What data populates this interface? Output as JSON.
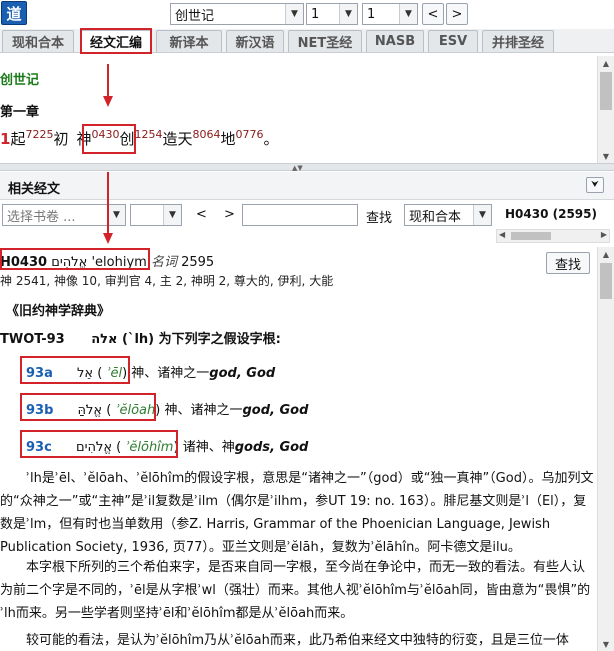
{
  "toolbar": {
    "logo": "道",
    "book_select": "创世记",
    "chapter_select": "1",
    "verse_select": "1",
    "prev": "<",
    "next": ">"
  },
  "tabs": [
    {
      "label": "现和合本",
      "active": false
    },
    {
      "label": "经文汇编",
      "active": true
    },
    {
      "label": "新译本",
      "active": false
    },
    {
      "label": "新汉语",
      "active": false
    },
    {
      "label": "NET圣经",
      "active": false
    },
    {
      "label": "NASB",
      "active": false
    },
    {
      "label": "ESV",
      "active": false
    },
    {
      "label": "并排圣经",
      "active": false
    }
  ],
  "passage": {
    "book": "创世记",
    "chapter": "第一章",
    "verse_num": "1",
    "words": [
      {
        "text": "起",
        "strong": "7225"
      },
      {
        "text": "初",
        "strong": ""
      },
      {
        "text": "神",
        "strong": "0430"
      },
      {
        "text": "创",
        "strong": "1254"
      },
      {
        "text": "造天",
        "strong": "8064"
      },
      {
        "text": "地",
        "strong": "0776"
      },
      {
        "text": "。",
        "strong": ""
      }
    ]
  },
  "related": {
    "title": "相关经文",
    "book_placeholder": "选择书卷 ...",
    "prev": "<",
    "next": ">",
    "search_label": "查找",
    "version": "现和合本",
    "lemma_header": "H0430 (2595)"
  },
  "lexicon": {
    "search_button": "查找",
    "code": "H0430",
    "hebrew": "אֱלֹהִים",
    "translit": "'elohiym",
    "pos": "名词",
    "count": "2595",
    "glosses": "神 2541, 神像 10, 审判官 4, 主 2, 神明 2, 尊大的, 伊利, 大能",
    "book_title": "《旧约神学辞典》",
    "twot_label": "TWOT-93",
    "twot_hebrew": "אלה",
    "twot_root": "(`lh) 为下列字之假设字根:",
    "entries": [
      {
        "id": "93a",
        "hebrew": "אֵל",
        "translit": "ʾēl",
        "gloss": "神、诸神之一",
        "eng": "god, God"
      },
      {
        "id": "93b",
        "hebrew": "אֱלֹהַּ",
        "translit": "ʾĕlōah",
        "gloss": "神、诸神之一",
        "eng": "god, God"
      },
      {
        "id": "93c",
        "hebrew": "אֱלֹהִים",
        "translit": "ʾĕlōhîm",
        "gloss": "诸神、神",
        "eng": "gods, God"
      }
    ],
    "p1": "ʾlh是ʾēl、ʾĕlōah、ʾĕlōhîm的假设字根，意思是“诸神之一”（god）或“独一真神”（God）。乌加列文的“众神之一”或“主神”是ʾil复数是ʾilm（偶尔是ʾilhm，参UT 19: no. 163）。腓尼基文则是ʾl（El），复数是ʾlm，但有时也当单数用（参Z. Harris, Grammar of the Phoenician Language, Jewish Publication Society, 1936, 页77）。亚兰文则是ʾĕlāh，复数为ʾĕlāhîn。阿卡德文是ilu。",
    "p2": "本字根下所列的三个希伯来字，是否来自同一字根，至今尚在争论中，而无一致的看法。有些人认为前二个字是不同的，ʾēl是从字根ʾwl（强壮）而来。其他人视ʾĕlōhîm与ʾĕlōah同，皆由意为“畏惧”的ʾlh而来。另一些学者则坚持ʾēl和ʾĕlōhîm都是从ʾĕlōah而来。",
    "p3": "较可能的看法，是认为ʾĕlōhîm乃从ʾĕlōah而来，此乃希伯来经文中独特的衍变，且是三位一体"
  }
}
